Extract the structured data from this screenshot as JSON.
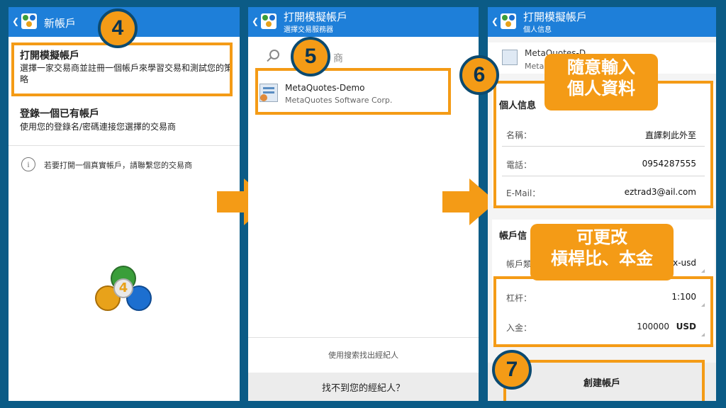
{
  "panel1": {
    "header_title": "新帳戶",
    "demo_title": "打開模擬帳戶",
    "demo_desc": "選擇一家交易商並註冊一個帳戶來學習交易和測試您的策略",
    "login_title": "登錄一個已有帳戶",
    "login_desc": "使用您的登錄名/密碼連接您選擇的交易商",
    "info_text": "若要打開一個真實帳戶，請聯繫您的交易商",
    "logo_number": "4",
    "step": "4"
  },
  "panel2": {
    "header_title": "打開模擬帳戶",
    "header_sub": "選擇交易服務器",
    "search_suffix": "商",
    "server_name": "MetaQuotes-Demo",
    "server_company": "MetaQuotes Software Corp.",
    "find_by_search": "使用搜索找出經紀人",
    "not_found": "找不到您的經紀人？",
    "step": "5"
  },
  "panel3": {
    "header_title": "打開模擬帳戶",
    "header_sub": "個人信息",
    "server_partial": "MetaQuotes-D",
    "server_partial2": "Meta",
    "section_personal": "個人信息",
    "fields": [
      {
        "label": "名稱：",
        "value": "直譯刺此外至"
      },
      {
        "label": "電話：",
        "value": "0954287555"
      },
      {
        "label": "E-Mail：",
        "value": "eztrad3@ail.com"
      }
    ],
    "section_account": "帳戶信",
    "account_type_label": "帳戶類",
    "account_type_value": "x-usd",
    "leverage_label": "杠杆：",
    "leverage_value": "1:100",
    "deposit_label": "入金：",
    "deposit_value": "100000",
    "deposit_currency": "USD",
    "create_button": "創建帳戶",
    "step6": "6",
    "step7": "7",
    "callout1_line1": "隨意輸入",
    "callout1_line2": "個人資料",
    "callout2_line1": "可更改",
    "callout2_line2": "槓桿比、本金"
  },
  "colors": {
    "accent": "#f49b16",
    "appbar": "#1e7fd9",
    "background": "#0b5b86"
  }
}
